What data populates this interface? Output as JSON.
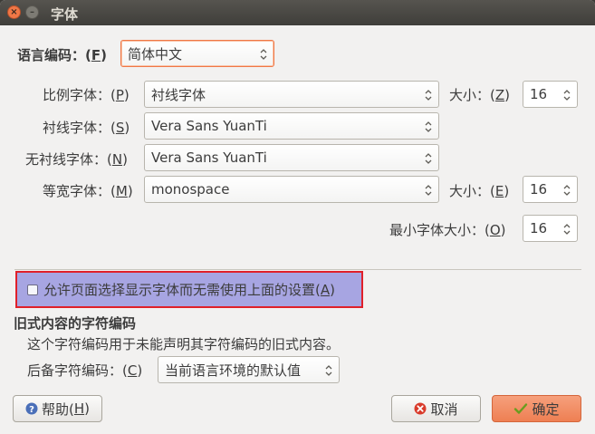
{
  "window": {
    "title": "字体",
    "close_glyph": "×",
    "minimize_glyph": "–"
  },
  "language": {
    "label": "语言编码：(",
    "mnemonic": "F",
    "label_end": ")",
    "value": "简体中文"
  },
  "proportional": {
    "label": "比例字体：(",
    "mnemonic": "P",
    "label_end": ")",
    "value": "衬线字体",
    "size_label": "大小：(",
    "size_mnemonic": "Z",
    "size_label_end": ")",
    "size_value": "16"
  },
  "serif": {
    "label": "衬线字体：(",
    "mnemonic": "S",
    "label_end": ")",
    "value": "Vera Sans YuanTi"
  },
  "sans_serif": {
    "label": "无衬线字体：(",
    "mnemonic": "N",
    "label_end": ")",
    "value": "Vera Sans YuanTi"
  },
  "monospace": {
    "label": "等宽字体：(",
    "mnemonic": "M",
    "label_end": ")",
    "value": "monospace",
    "size_label": "大小：(",
    "size_mnemonic": "E",
    "size_label_end": ")",
    "size_value": "16"
  },
  "min_size": {
    "label": "最小字体大小：(",
    "mnemonic": "O",
    "label_end": ")",
    "value": "16"
  },
  "allow_page_fonts": {
    "label": "允许页面选择显示字体而无需使用上面的设置(",
    "mnemonic": "A",
    "label_end": ")",
    "checked": false
  },
  "legacy": {
    "heading": "旧式内容的字符编码",
    "description": "这个字符编码用于未能声明其字符编码的旧式内容。",
    "fallback_label": "后备字符编码：(",
    "fallback_mnemonic": "C",
    "fallback_label_end": ")",
    "fallback_value": "当前语言环境的默认值"
  },
  "buttons": {
    "help_label": "帮助(",
    "help_mnemonic": "H",
    "help_label_end": ")",
    "cancel": "取消",
    "ok": "确定"
  },
  "colors": {
    "accent": "#f07746",
    "highlight": "#a7a5e2",
    "highlight_border": "#e0202a"
  }
}
